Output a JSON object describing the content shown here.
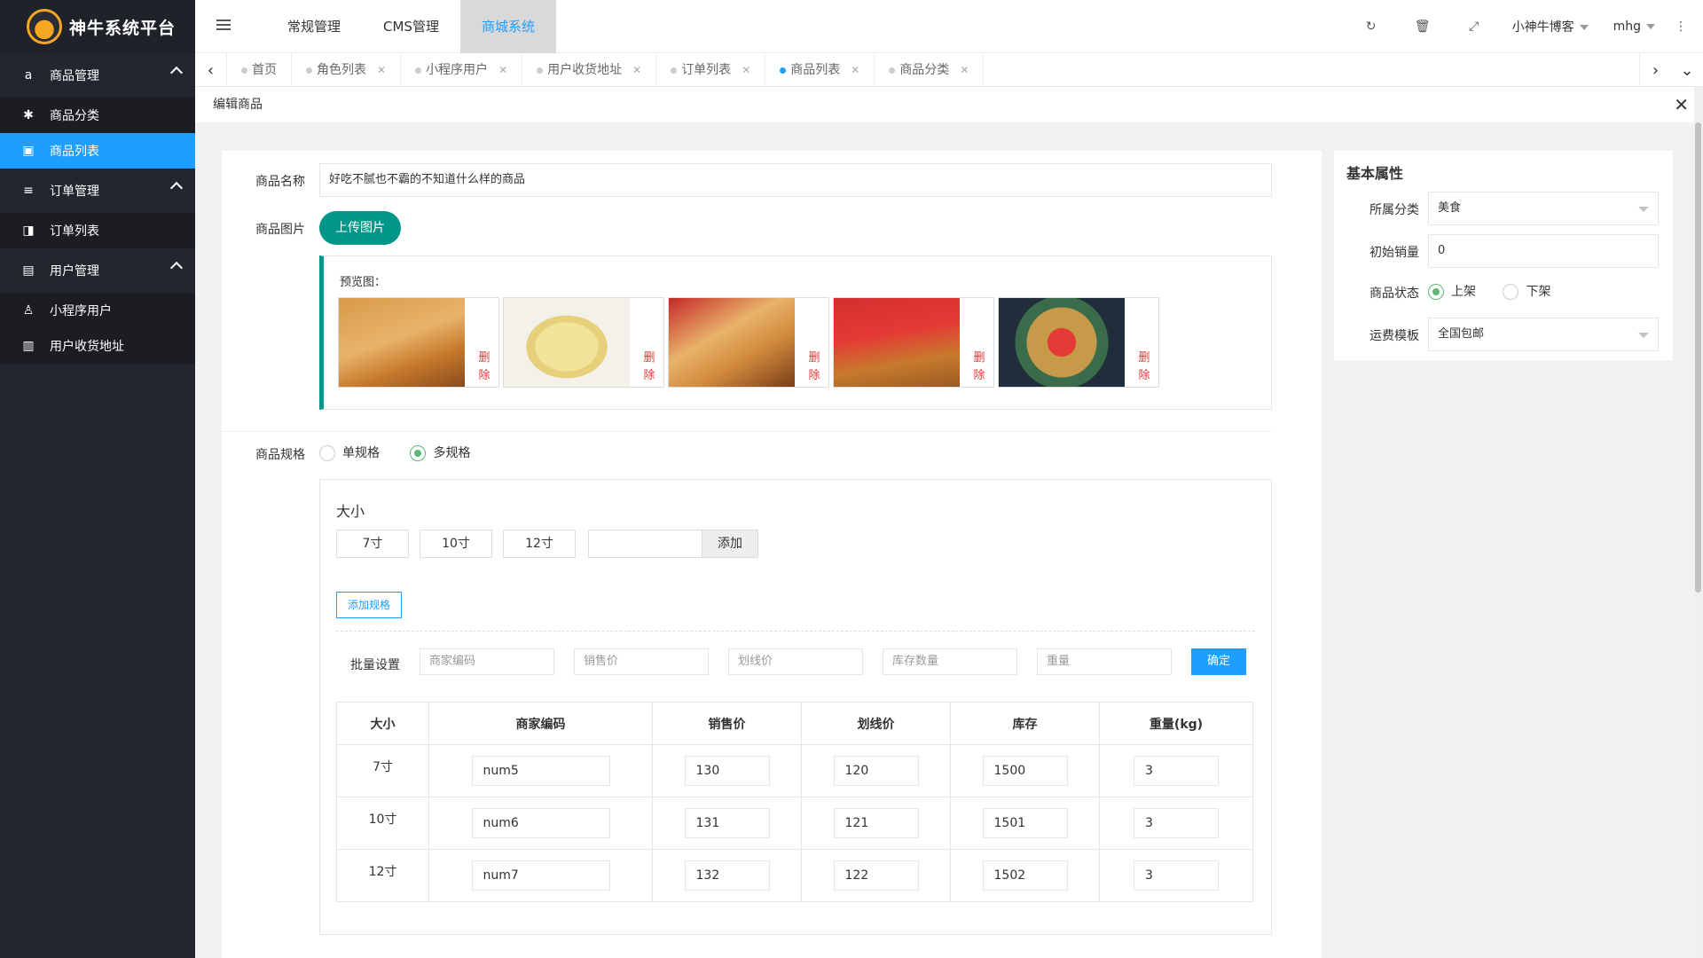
{
  "app": {
    "logo_text": "神牛系统平台"
  },
  "sidebar": {
    "groups": [
      {
        "label": "商品管理",
        "items": [
          {
            "label": "商品分类"
          },
          {
            "label": "商品列表"
          }
        ]
      },
      {
        "label": "订单管理",
        "items": [
          {
            "label": "订单列表"
          }
        ]
      },
      {
        "label": "用户管理",
        "items": [
          {
            "label": "小程序用户"
          },
          {
            "label": "用户收货地址"
          }
        ]
      }
    ],
    "active_item": "商品列表"
  },
  "header": {
    "menus": [
      {
        "label": "常规管理"
      },
      {
        "label": "CMS管理"
      },
      {
        "label": "商城系统"
      }
    ],
    "active_menu": "商城系统",
    "user": "小神牛博客",
    "account": "mhg",
    "icons": [
      "refresh-icon",
      "trash-icon",
      "fullscreen-icon",
      "more-icon"
    ]
  },
  "tabs": [
    {
      "label": "首页"
    },
    {
      "label": "角色列表"
    },
    {
      "label": "小程序用户"
    },
    {
      "label": "用户收货地址"
    },
    {
      "label": "订单列表"
    },
    {
      "label": "商品列表"
    },
    {
      "label": "商品分类"
    }
  ],
  "active_tab": "商品列表",
  "page": {
    "title": "编辑商品"
  },
  "form": {
    "name_label": "商品名称",
    "name_value": "好吃不腻也不霸的不知道什么样的商品",
    "image_label": "商品图片",
    "upload_label": "上传图片",
    "preview_label": "预览图：",
    "delete_label_1": "删",
    "delete_label_2": "除",
    "thumbnails": [
      "pastry-on-board",
      "sponge-cake",
      "pastry-with-box",
      "pastry-red-bg",
      "noodle-dish"
    ],
    "spec_label": "商品规格",
    "spec_single": "单规格",
    "spec_multi": "多规格",
    "spec_selected": "多规格",
    "spec_group_title": "大小",
    "spec_values": [
      "7寸",
      "10寸",
      "12寸"
    ],
    "add_label": "添加",
    "add_spec_label": "添加规格",
    "batch_label": "批量设置",
    "batch_placeholders": [
      "商家编码",
      "销售价",
      "划线价",
      "库存数量",
      "重量"
    ],
    "confirm_label": "确定",
    "table": {
      "headers": [
        "大小",
        "商家编码",
        "销售价",
        "划线价",
        "库存",
        "重量(kg)"
      ],
      "rows": [
        {
          "size": "7寸",
          "code": "num5",
          "price": "130",
          "original": "120",
          "stock": "1500",
          "weight": "3"
        },
        {
          "size": "10寸",
          "code": "num6",
          "price": "131",
          "original": "121",
          "stock": "1501",
          "weight": "3"
        },
        {
          "size": "12寸",
          "code": "num7",
          "price": "132",
          "original": "122",
          "stock": "1502",
          "weight": "3"
        }
      ]
    }
  },
  "attributes": {
    "title": "基本属性",
    "category_label": "所属分类",
    "category_value": "美食",
    "sales_label": "初始销量",
    "sales_value": "0",
    "status_label": "商品状态",
    "status_on": "上架",
    "status_off": "下架",
    "status_selected": "上架",
    "shipping_label": "运费模板",
    "shipping_value": "全国包邮"
  },
  "colors": {
    "primary": "#1e9fff",
    "teal": "#009688",
    "sidebar": "#23262e",
    "delete": "#e53935",
    "radio_on": "#5fb878"
  }
}
